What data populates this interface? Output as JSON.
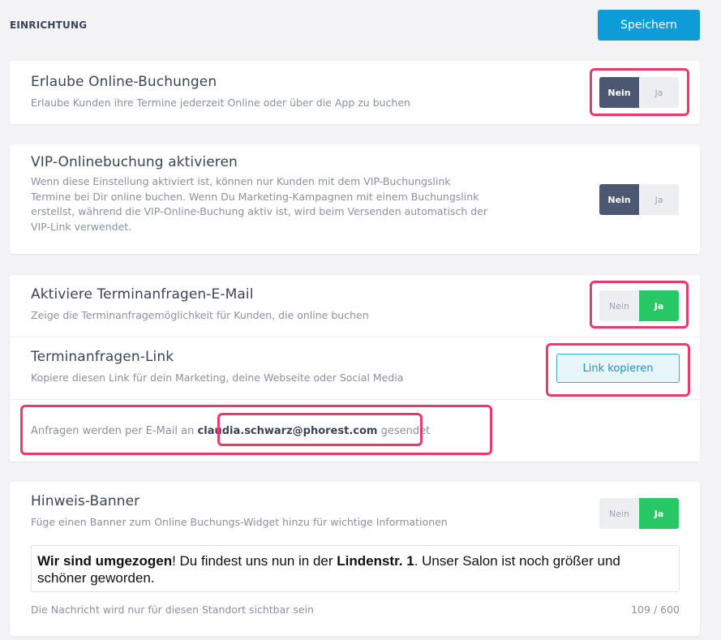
{
  "header": {
    "title": "EINRICHTUNG",
    "save_label": "Speichern"
  },
  "online_booking": {
    "title": "Erlaube Online-Buchungen",
    "description": "Erlaube Kunden ihre Termine jederzeit Online oder über die App zu buchen",
    "no_label": "Nein",
    "yes_label": "Ja",
    "value": "Nein"
  },
  "vip_booking": {
    "title": "VIP-Onlinebuchung aktivieren",
    "description_lines": [
      "Wenn diese Einstellung aktiviert ist, können nur Kunden mit dem VIP-Buchungslink",
      "Termine bei Dir online buchen. Wenn Du Marketing-Kampagnen mit einem Buchungslink",
      "erstellst, während die VIP-Online-Buchung aktiv ist, wird beim Versenden automatisch der",
      "VIP-Link verwendet."
    ],
    "no_label": "Nein",
    "yes_label": "Ja",
    "value": "Nein"
  },
  "request_email": {
    "title": "Aktiviere Terminanfragen-E-Mail",
    "description": "Zeige die Terminanfragemöglichkeit für Kunden, die online buchen",
    "no_label": "Nein",
    "yes_label": "Ja",
    "value": "Ja"
  },
  "request_link": {
    "title": "Terminanfragen-Link",
    "description": "Kopiere diesen Link für dein Marketing, deine Webseite oder Social Media",
    "button_label": "Link kopieren"
  },
  "email_info": {
    "prefix": "Anfragen werden per E-Mail an ",
    "email": "claudia.schwarz@phorest.com",
    "suffix": " gesendet"
  },
  "banner": {
    "title": "Hinweis-Banner",
    "description": "Füge einen Banner zum Online Buchungs-Widget hinzu für wichtige Informationen",
    "no_label": "Nein",
    "yes_label": "Ja",
    "value": "Ja",
    "message_bold_1": "Wir sind umgezogen",
    "message_text_1": "! Du findest uns nun in der ",
    "message_bold_2": "Lindenstr. 1",
    "message_text_2": ". Unser Salon ist noch größer und schöner geworden.",
    "footer_note": "Die Nachricht wird nur für diesen Standort sichtbar sein",
    "char_count": "109 / 600"
  },
  "colors": {
    "accent": "#0e9cd8",
    "toggle_no_active": "#4c5872",
    "toggle_yes_active": "#28c864",
    "highlight": "#e93a6b"
  }
}
